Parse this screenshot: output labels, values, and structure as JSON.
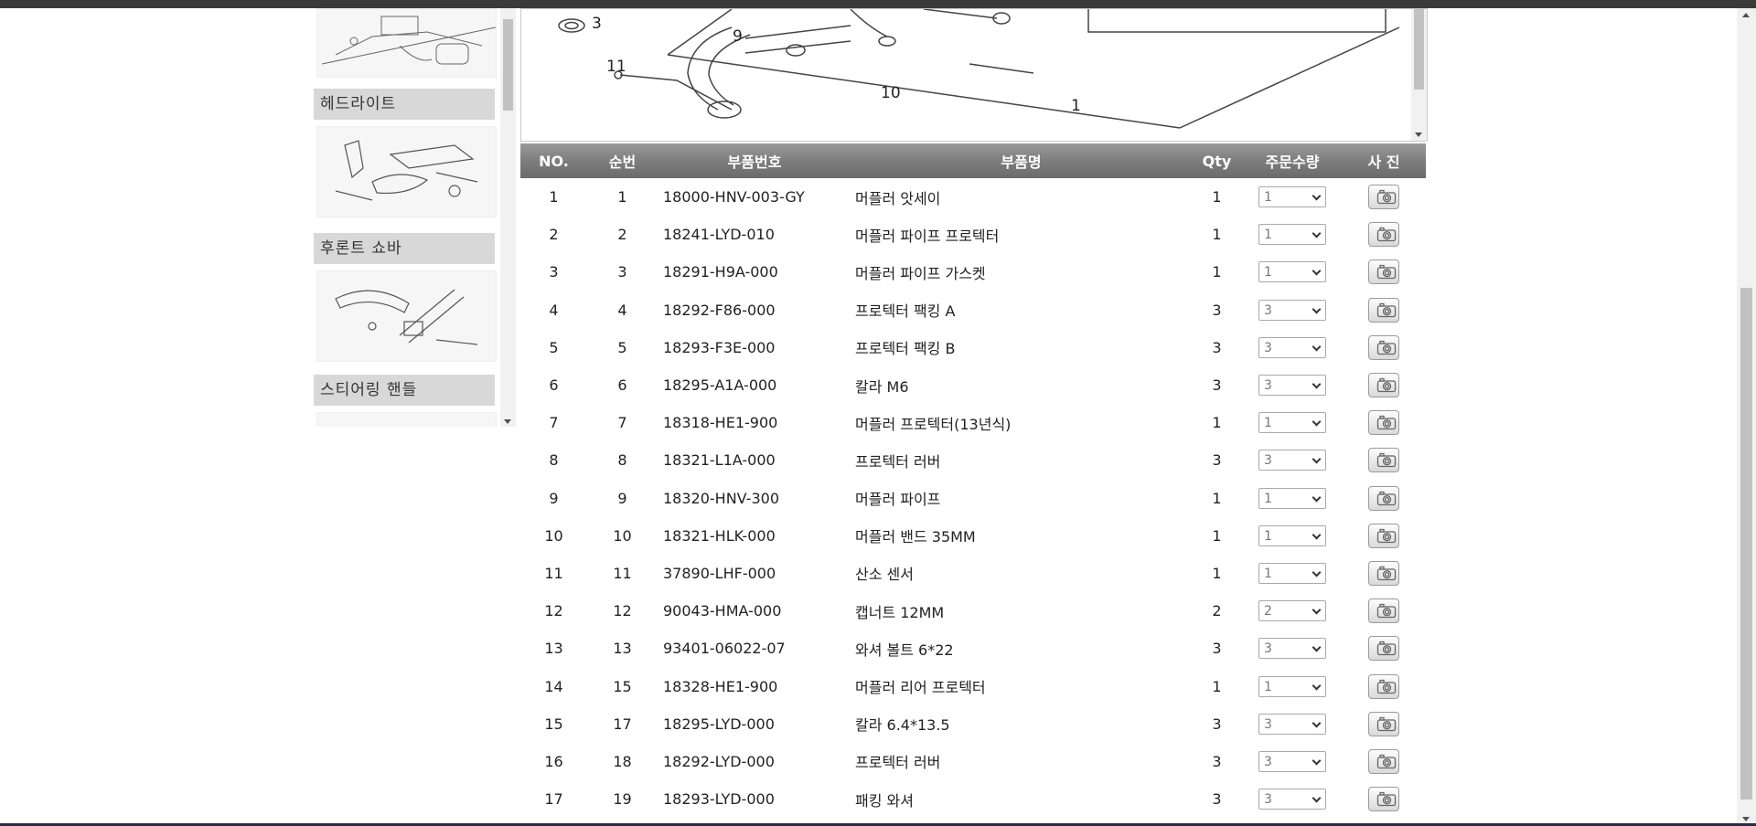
{
  "catalog": {
    "sections": [
      {
        "label": "헤드라이트"
      },
      {
        "label": "후론트 쇼바"
      },
      {
        "label": "스티어링 핸들"
      }
    ]
  },
  "diagram": {
    "callouts": [
      "3",
      "9",
      "11",
      "10",
      "1"
    ]
  },
  "table": {
    "headers": {
      "no": "NO.",
      "seq": "순번",
      "part_no": "부품번호",
      "part_name": "부품명",
      "qty": "Qty",
      "order_qty": "주문수량",
      "photo": "사 진"
    },
    "rows": [
      {
        "no": "1",
        "seq": "1",
        "part_no": "18000-HNV-003-GY",
        "name": "머플러 앗세이",
        "qty": "1",
        "order": "1"
      },
      {
        "no": "2",
        "seq": "2",
        "part_no": "18241-LYD-010",
        "name": "머플러 파이프 프로텍터",
        "qty": "1",
        "order": "1"
      },
      {
        "no": "3",
        "seq": "3",
        "part_no": "18291-H9A-000",
        "name": "머플러 파이프 가스켓",
        "qty": "1",
        "order": "1"
      },
      {
        "no": "4",
        "seq": "4",
        "part_no": "18292-F86-000",
        "name": "프로텍터 팩킹 A",
        "qty": "3",
        "order": "3"
      },
      {
        "no": "5",
        "seq": "5",
        "part_no": "18293-F3E-000",
        "name": "프로텍터 팩킹 B",
        "qty": "3",
        "order": "3"
      },
      {
        "no": "6",
        "seq": "6",
        "part_no": "18295-A1A-000",
        "name": "칼라 M6",
        "qty": "3",
        "order": "3"
      },
      {
        "no": "7",
        "seq": "7",
        "part_no": "18318-HE1-900",
        "name": "머플러 프로텍터(13년식)",
        "qty": "1",
        "order": "1"
      },
      {
        "no": "8",
        "seq": "8",
        "part_no": "18321-L1A-000",
        "name": "프로텍터 러버",
        "qty": "3",
        "order": "3"
      },
      {
        "no": "9",
        "seq": "9",
        "part_no": "18320-HNV-300",
        "name": "머플러 파이프",
        "qty": "1",
        "order": "1"
      },
      {
        "no": "10",
        "seq": "10",
        "part_no": "18321-HLK-000",
        "name": "머플러 밴드 35MM",
        "qty": "1",
        "order": "1"
      },
      {
        "no": "11",
        "seq": "11",
        "part_no": "37890-LHF-000",
        "name": "산소 센서",
        "qty": "1",
        "order": "1"
      },
      {
        "no": "12",
        "seq": "12",
        "part_no": "90043-HMA-000",
        "name": "캡너트 12MM",
        "qty": "2",
        "order": "2"
      },
      {
        "no": "13",
        "seq": "13",
        "part_no": "93401-06022-07",
        "name": "와셔 볼트 6*22",
        "qty": "3",
        "order": "3"
      },
      {
        "no": "14",
        "seq": "15",
        "part_no": "18328-HE1-900",
        "name": "머플러 리어 프로텍터",
        "qty": "1",
        "order": "1"
      },
      {
        "no": "15",
        "seq": "17",
        "part_no": "18295-LYD-000",
        "name": "칼라 6.4*13.5",
        "qty": "3",
        "order": "3"
      },
      {
        "no": "16",
        "seq": "18",
        "part_no": "18292-LYD-000",
        "name": "프로텍터 러버",
        "qty": "3",
        "order": "3"
      },
      {
        "no": "17",
        "seq": "19",
        "part_no": "18293-LYD-000",
        "name": "패킹 와셔",
        "qty": "3",
        "order": "3"
      }
    ]
  },
  "icons": {
    "photo": "camera-icon",
    "order": "chevron-down-icon"
  },
  "colors": {
    "header_bg": "#7d7d7d",
    "section_bg": "#d8d8d8",
    "scrollbar": "#c1c1c1"
  }
}
